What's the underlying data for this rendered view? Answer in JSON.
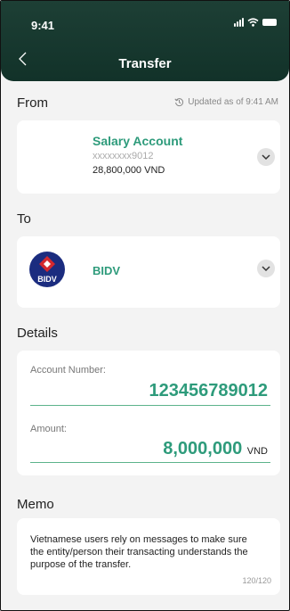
{
  "status_bar": {
    "time": "9:41"
  },
  "header": {
    "title": "Transfer"
  },
  "from": {
    "label": "From",
    "updated": "Updated as of 9:41 AM",
    "account_name": "Salary Account",
    "account_number": "xxxxxxxx9012",
    "balance": "28,800,000 VND"
  },
  "to": {
    "label": "To",
    "bank_name": "BIDV",
    "logo_text": "BIDV"
  },
  "details": {
    "label": "Details",
    "account_number_label": "Account Number:",
    "account_number_value": "123456789012",
    "amount_label": "Amount:",
    "amount_value": "8,000,000",
    "amount_unit": "VND"
  },
  "memo": {
    "label": "Memo",
    "text": "Vietnamese users rely on messages to make sure the entity/person their transacting understands the purpose of the transfer.",
    "counter": "120/120"
  },
  "colors": {
    "header": "#1d3f35",
    "accent": "#2e9b7b",
    "wallet": "#5cb38b",
    "bidv_blue": "#1b2c7f",
    "bidv_red": "#d3282f"
  },
  "icons": [
    "back-chevron-icon",
    "signal-icon",
    "wifi-icon",
    "battery-icon",
    "history-icon",
    "wallet-icon",
    "chevron-down-icon",
    "bidv-logo"
  ]
}
